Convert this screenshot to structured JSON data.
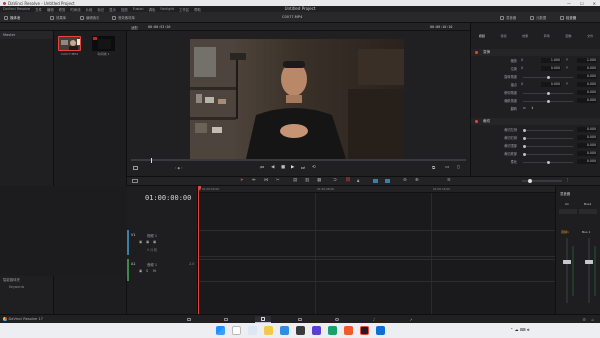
{
  "os": {
    "window_title": "DaVinci Resolve - Untitled Project",
    "clock_time": "",
    "clock_date": ""
  },
  "menu": {
    "items": [
      "DaVinci Resolve",
      "文件",
      "编辑",
      "修剪",
      "时间线",
      "片段",
      "标记",
      "显示",
      "回放",
      "Fusion",
      "调色",
      "Fairlight",
      "工作区",
      "帮助"
    ],
    "project_title": "Untitled Project"
  },
  "toolbar": {
    "media_pool": "媒体池",
    "effects": "效果库",
    "edit_index": "编辑索引",
    "sound_library": "音效素材库",
    "mixer": "混音器",
    "metadata": "元数据",
    "inspector": "检查器",
    "timeline_name": "C0077.MP4"
  },
  "subbar": {
    "zoom": "适配",
    "timecode_left": "00:00:53:20",
    "clip_name": "C0077.MP4",
    "timecode_right": "00:00:10:10",
    "inspector_tab": "检查器",
    "inspector_clip": "C0077.MP4"
  },
  "media_pool": {
    "bin_master": "Master",
    "clips": [
      {
        "name": "C0077.MP4"
      },
      {
        "name": "时间线 1"
      }
    ],
    "smart_bins_header": "智能媒体夹",
    "smart_bins_item": "Keywords"
  },
  "viewer": {
    "playback_icons": [
      "previous-icon",
      "stop-icon",
      "play-icon",
      "next-icon",
      "loop-icon"
    ]
  },
  "inspector": {
    "tabs": [
      "视频",
      "音频",
      "效果",
      "转场",
      "图像",
      "文件"
    ],
    "section_transform": "变换",
    "transform_rows": [
      {
        "name": "缩放",
        "x_label": "X",
        "x": "1.000",
        "y_label": "Y",
        "y": "1.000"
      },
      {
        "name": "位置",
        "x_label": "X",
        "x": "0.000",
        "y_label": "Y",
        "y": "0.000"
      },
      {
        "name": "旋转角度",
        "value": "0.000"
      },
      {
        "name": "锚点",
        "x_label": "X",
        "x": "0.000",
        "y_label": "Y",
        "y": "0.000"
      },
      {
        "name": "俯仰角度",
        "value": "0.000"
      },
      {
        "name": "偏航角度",
        "value": "0.000"
      },
      {
        "name": "翻转",
        "value": ""
      }
    ],
    "section_crop": "裁切",
    "crop_rows": [
      {
        "name": "裁切左侧",
        "value": "0.000"
      },
      {
        "name": "裁切右侧",
        "value": "0.000"
      },
      {
        "name": "裁切顶部",
        "value": "0.000"
      },
      {
        "name": "裁切底部",
        "value": "0.000"
      },
      {
        "name": "柔化",
        "value": "0.000"
      }
    ]
  },
  "timeline": {
    "timecode": "01:00:00:00",
    "ruler_marks": [
      "01:00:00:00",
      "01:00:08:00",
      "01:00:16:00"
    ],
    "video_track": {
      "id": "V1",
      "name": "视频 1",
      "clip_count": "0 片段"
    },
    "audio_track": {
      "id": "A1",
      "name": "音频 1",
      "level": "2.0"
    }
  },
  "mixer": {
    "header": "混音器",
    "tracks": [
      "A1",
      "Bus1"
    ],
    "labels": [
      "音频1",
      "Bus 1"
    ]
  },
  "pagebar": {
    "brand": "DaVinci Resolve 17"
  },
  "colors": {
    "accent_red": "#e0463a",
    "video_track": "#3a7fa8",
    "audio_track": "#3f8a4a",
    "highlight_orange": "#e89a2a"
  }
}
